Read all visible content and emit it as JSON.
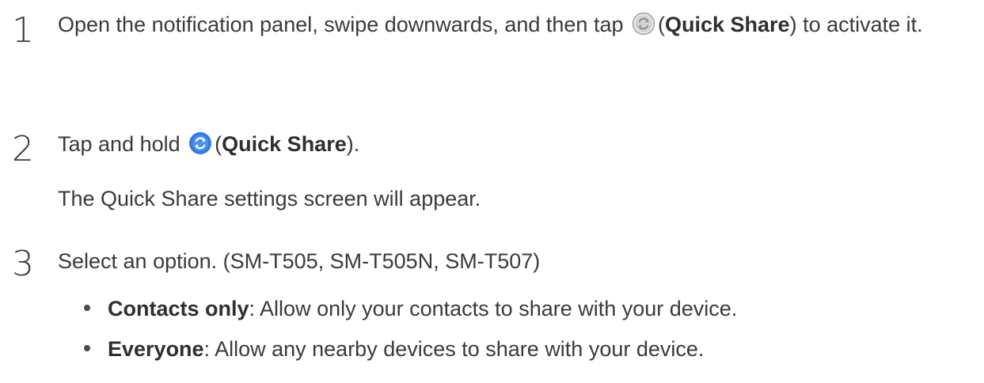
{
  "steps": [
    {
      "number": "1",
      "text_before_icon": "Open the notification panel, swipe downwards, and then tap",
      "icon": "quick-share-icon-inactive",
      "text_open_paren": "(",
      "bold": "Quick Share",
      "text_after_bold": ") to activate it."
    },
    {
      "number": "2",
      "text_before_icon": "Tap and hold",
      "icon": "quick-share-icon-active",
      "text_open_paren": "(",
      "bold": "Quick Share",
      "text_after_bold": ").",
      "subtext": "The Quick Share settings screen will appear."
    },
    {
      "number": "3",
      "text": "Select an option. (SM-T505, SM-T505N, SM-T507)",
      "bullets": [
        {
          "bold": "Contacts only",
          "text": ": Allow only your contacts to share with your device."
        },
        {
          "bold": "Everyone",
          "text": ": Allow any nearby devices to share with your device."
        }
      ]
    }
  ],
  "colors": {
    "text": "#3a3a3a",
    "icon_active": "#2f7de1",
    "icon_inactive": "#bdbdbd"
  }
}
